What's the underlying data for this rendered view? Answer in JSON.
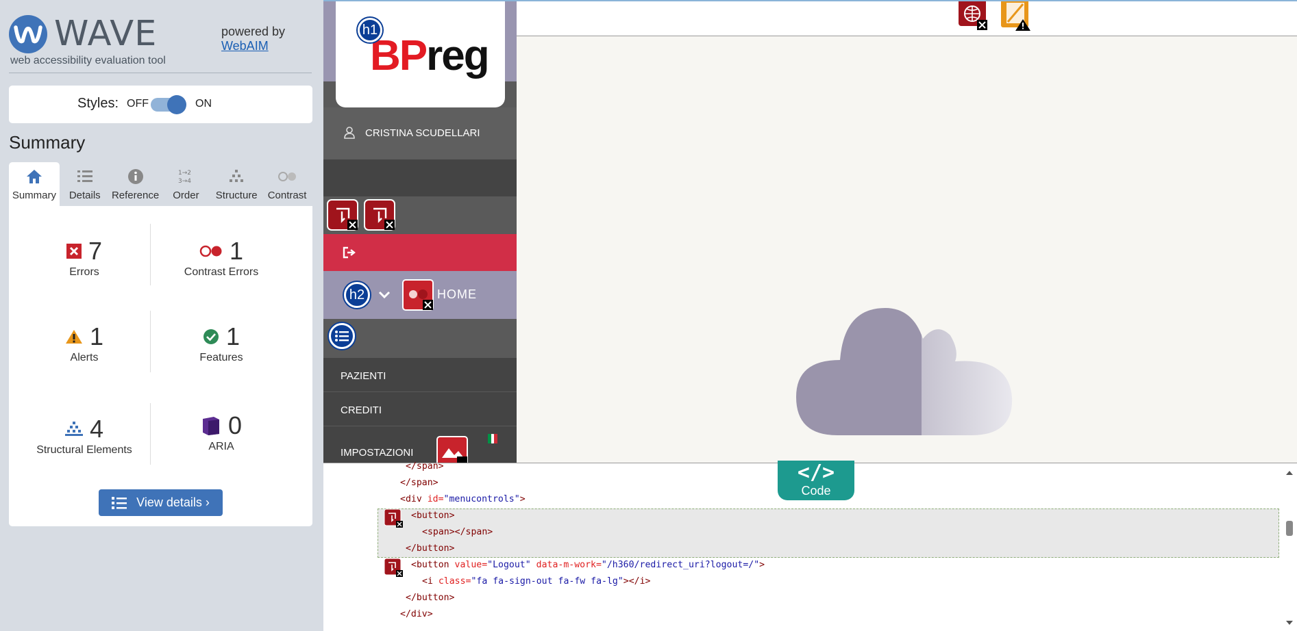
{
  "wave": {
    "title": "WAVE",
    "tagline": "web accessibility evaluation tool",
    "powered_by": "powered by",
    "webaim_link": "WebAIM",
    "styles_label": "Styles:",
    "styles_off": "OFF",
    "styles_on": "ON",
    "styles_enabled": true,
    "summary_heading": "Summary",
    "tabs": [
      {
        "label": "Summary",
        "icon": "home-icon",
        "active": true
      },
      {
        "label": "Details",
        "icon": "list-icon",
        "active": false
      },
      {
        "label": "Reference",
        "icon": "info-icon",
        "active": false
      },
      {
        "label": "Order",
        "icon": "order-icon",
        "active": false
      },
      {
        "label": "Structure",
        "icon": "structure-icon",
        "active": false
      },
      {
        "label": "Contrast",
        "icon": "contrast-icon",
        "active": false
      }
    ],
    "stats": {
      "errors": {
        "value": "7",
        "label": "Errors",
        "color": "#c8232c"
      },
      "contrast_errors": {
        "value": "1",
        "label": "Contrast Errors",
        "color": "#c8232c"
      },
      "alerts": {
        "value": "1",
        "label": "Alerts",
        "color": "#e8961a"
      },
      "features": {
        "value": "1",
        "label": "Features",
        "color": "#2e8b57"
      },
      "structural": {
        "value": "4",
        "label": "Structural Elements",
        "color": "#3f73b8"
      },
      "aria": {
        "value": "0",
        "label": "ARIA",
        "color": "#5c2d91"
      }
    },
    "view_details": "View details ›",
    "accent": "#3f73b8"
  },
  "preview": {
    "logo_text_b": "BP",
    "logo_text_r": "reg",
    "user_name": "CRISTINA SCUDELLARI",
    "home_label": "HOME",
    "menu": [
      {
        "label": "PAZIENTI"
      },
      {
        "label": "CREDITI"
      },
      {
        "label": "IMPOSTAZIONI"
      }
    ],
    "heading_badges": [
      "h1",
      "h2"
    ],
    "logout_bar_color": "#d12e47",
    "nav_color": "#9995b0"
  },
  "code": {
    "tab_symbol": "</>",
    "tab_label": "Code",
    "lines": [
      {
        "indent": 5,
        "parts": [
          [
            "tag",
            "</span>"
          ]
        ]
      },
      {
        "indent": 4,
        "parts": [
          [
            "tag",
            "</span>"
          ]
        ]
      },
      {
        "indent": 4,
        "parts": [
          [
            "tag",
            "<div "
          ],
          [
            "attr",
            "id="
          ],
          [
            "val",
            "\"menucontrols\""
          ],
          [
            "tag",
            ">"
          ]
        ]
      },
      {
        "indent": 6,
        "parts": [
          [
            "tag",
            "<button>"
          ]
        ]
      },
      {
        "indent": 8,
        "parts": [
          [
            "tag",
            "<span></span>"
          ]
        ]
      },
      {
        "indent": 5,
        "parts": [
          [
            "tag",
            "</button>"
          ]
        ]
      },
      {
        "indent": 6,
        "parts": [
          [
            "tag",
            "<button "
          ],
          [
            "attr",
            "value="
          ],
          [
            "val",
            "\"Logout\""
          ],
          [
            "attr",
            " data-m-work="
          ],
          [
            "val",
            "\"/h360/redirect_uri?logout=/\""
          ],
          [
            "tag",
            ">"
          ]
        ]
      },
      {
        "indent": 8,
        "parts": [
          [
            "tag",
            "<i "
          ],
          [
            "attr",
            "class="
          ],
          [
            "val",
            "\"fa fa-sign-out fa-fw fa-lg\""
          ],
          [
            "tag",
            "></i>"
          ]
        ]
      },
      {
        "indent": 5,
        "parts": [
          [
            "tag",
            "</button>"
          ]
        ]
      },
      {
        "indent": 4,
        "parts": [
          [
            "tag",
            "</div>"
          ]
        ]
      }
    ]
  }
}
